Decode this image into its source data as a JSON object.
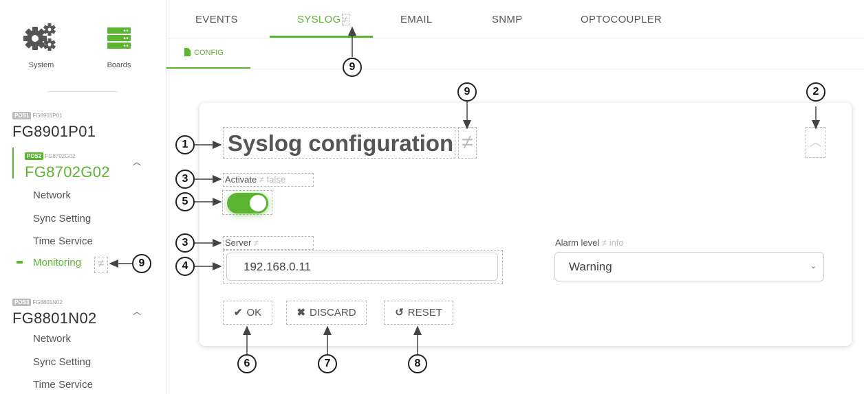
{
  "sidebar": {
    "nav": [
      {
        "label": "System",
        "icon": "gears-icon"
      },
      {
        "label": "Boards",
        "icon": "server-stack-icon"
      }
    ],
    "boards": [
      {
        "pos": "POS1",
        "sub": "FG8901P01",
        "name": "FG8901P01",
        "expanded": false
      },
      {
        "pos": "POS2",
        "sub": "FG8702G02",
        "name": "FG8702G02",
        "expanded": true,
        "items": [
          "Network",
          "Sync Setting",
          "Time Service",
          "Monitoring"
        ],
        "active_item": "Monitoring"
      },
      {
        "pos": "POS3",
        "sub": "FG8801N02",
        "name": "FG8801N02",
        "expanded": true,
        "items": [
          "Network",
          "Sync Setting",
          "Time Service"
        ]
      }
    ],
    "monitoring_neq": "≠"
  },
  "tabs": {
    "items": [
      "EVENTS",
      "SYSLOG",
      "EMAIL",
      "SNMP",
      "OPTOCOUPLER"
    ],
    "active": "SYSLOG",
    "syslog_neq": "≠"
  },
  "subtabs": {
    "items": [
      "CONFIG"
    ],
    "active": "CONFIG"
  },
  "card": {
    "title": "Syslog configuration",
    "title_neq": "≠",
    "collapse_icon": "chevron-up-icon",
    "activate": {
      "label": "Activate",
      "neq": "≠",
      "default_value": "false",
      "on": true
    },
    "server": {
      "label": "Server",
      "neq": "≠",
      "value": "192.168.0.11"
    },
    "alarm_level": {
      "label": "Alarm level",
      "neq": "≠",
      "default_value": "info",
      "selected": "Warning"
    },
    "buttons": {
      "ok": "OK",
      "discard": "DISCARD",
      "reset": "RESET"
    }
  },
  "callouts": [
    "1",
    "2",
    "3",
    "3",
    "4",
    "5",
    "6",
    "7",
    "8",
    "9",
    "9",
    "9"
  ],
  "colors": {
    "accent": "#5cb531",
    "text": "#444444",
    "muted": "#bbbbbb",
    "border": "#d0d0d0"
  }
}
